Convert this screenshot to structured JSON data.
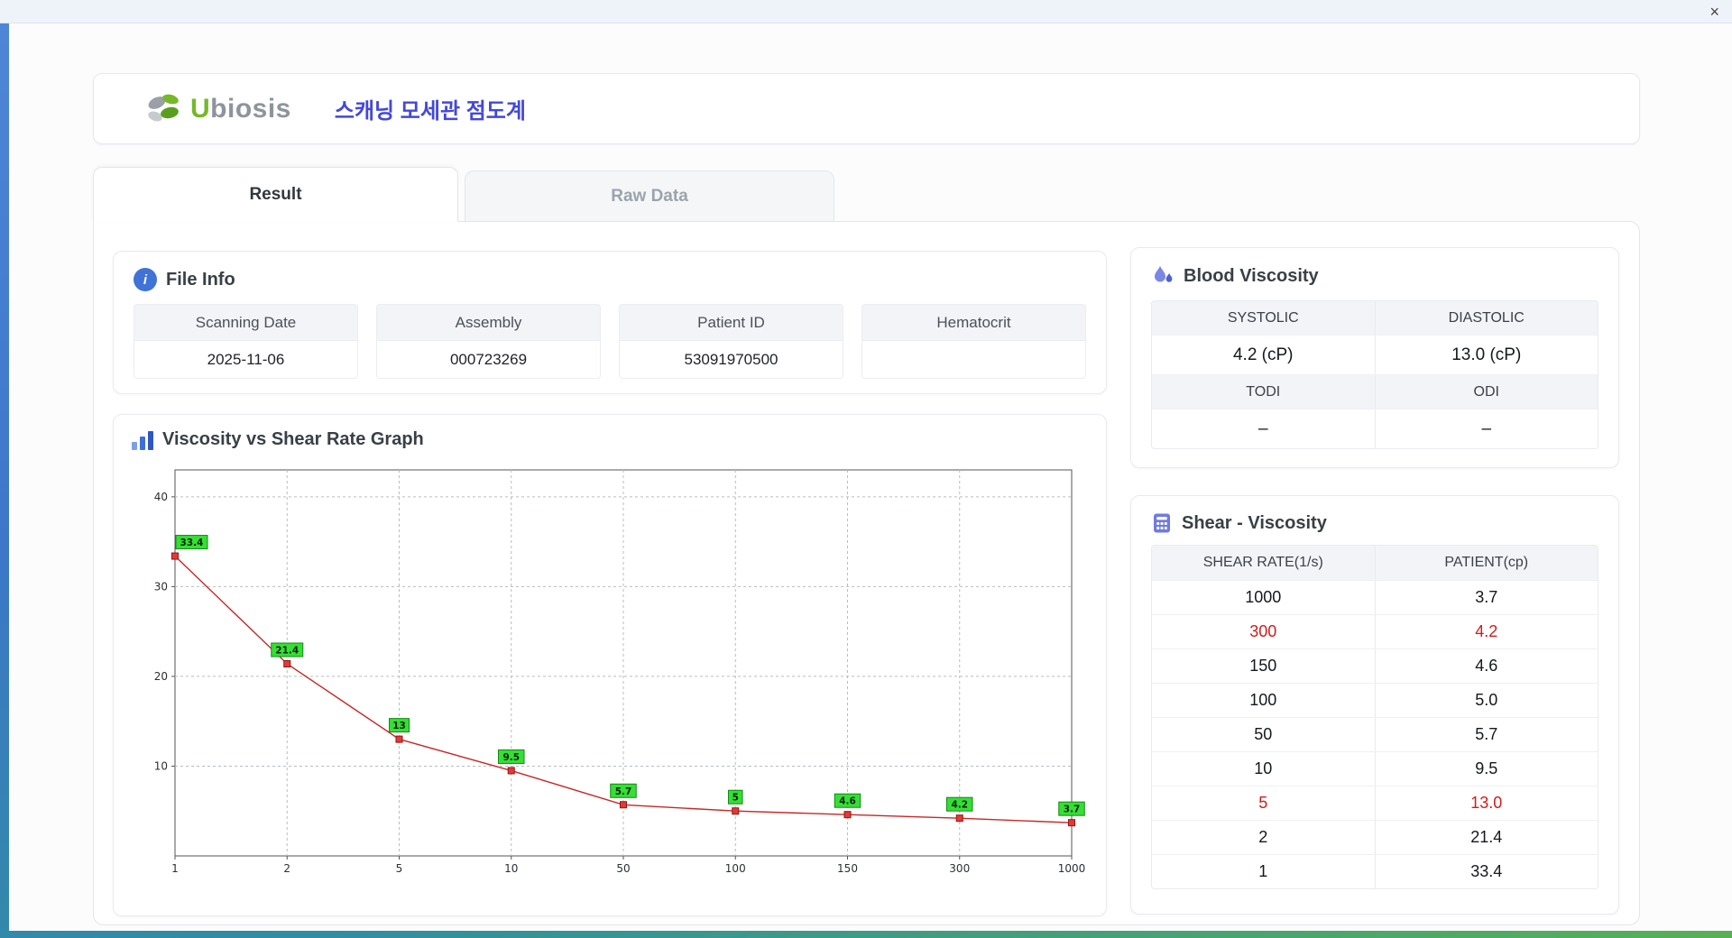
{
  "window": {
    "close": "×"
  },
  "header": {
    "brand_u": "U",
    "brand_rest": "biosis",
    "app_title": "스캐닝 모세관 점도계"
  },
  "tabs": [
    {
      "label": "Result"
    },
    {
      "label": "Raw Data"
    }
  ],
  "file_info": {
    "title": "File Info",
    "icon_glyph": "i",
    "fields": [
      {
        "label": "Scanning Date",
        "value": "2025-11-06"
      },
      {
        "label": "Assembly",
        "value": "000723269"
      },
      {
        "label": "Patient ID",
        "value": "53091970500"
      },
      {
        "label": "Hematocrit",
        "value": ""
      }
    ]
  },
  "graph": {
    "title": "Viscosity vs Shear Rate Graph"
  },
  "chart_data": {
    "type": "line",
    "title": "Viscosity vs Shear Rate Graph",
    "x_scale": "categorical",
    "categories": [
      "1",
      "2",
      "5",
      "10",
      "50",
      "100",
      "150",
      "300",
      "1000"
    ],
    "values": [
      33.4,
      21.4,
      13,
      9.5,
      5.7,
      5,
      4.6,
      4.2,
      3.7
    ],
    "point_labels": [
      "33.4",
      "21.4",
      "13",
      "9.5",
      "5.7",
      "5",
      "4.6",
      "4.2",
      "3.7"
    ],
    "xlabel": "",
    "ylabel": "",
    "ylim": [
      0,
      43
    ],
    "y_ticks": [
      10,
      20,
      30,
      40
    ],
    "grid": "dashed",
    "legend": "none",
    "line_color": "#c62828",
    "marker_color": "#e53935",
    "label_bg": "#35df35"
  },
  "blood_viscosity": {
    "title": "Blood Viscosity",
    "cells": [
      {
        "label": "SYSTOLIC",
        "value": "4.2 (cP)"
      },
      {
        "label": "DIASTOLIC",
        "value": "13.0 (cP)"
      },
      {
        "label": "TODI",
        "value": "–"
      },
      {
        "label": "ODI",
        "value": "–"
      }
    ]
  },
  "shear_table": {
    "title": "Shear - Viscosity",
    "columns": [
      "SHEAR RATE(1/s)",
      "PATIENT(cp)"
    ],
    "rows": [
      {
        "rate": "1000",
        "patient": "3.7"
      },
      {
        "rate": "300",
        "patient": "4.2"
      },
      {
        "rate": "150",
        "patient": "4.6"
      },
      {
        "rate": "100",
        "patient": "5.0"
      },
      {
        "rate": "50",
        "patient": "5.7"
      },
      {
        "rate": "10",
        "patient": "9.5"
      },
      {
        "rate": "5",
        "patient": "13.0"
      },
      {
        "rate": "2",
        "patient": "21.4"
      },
      {
        "rate": "1",
        "patient": "33.4"
      }
    ]
  }
}
